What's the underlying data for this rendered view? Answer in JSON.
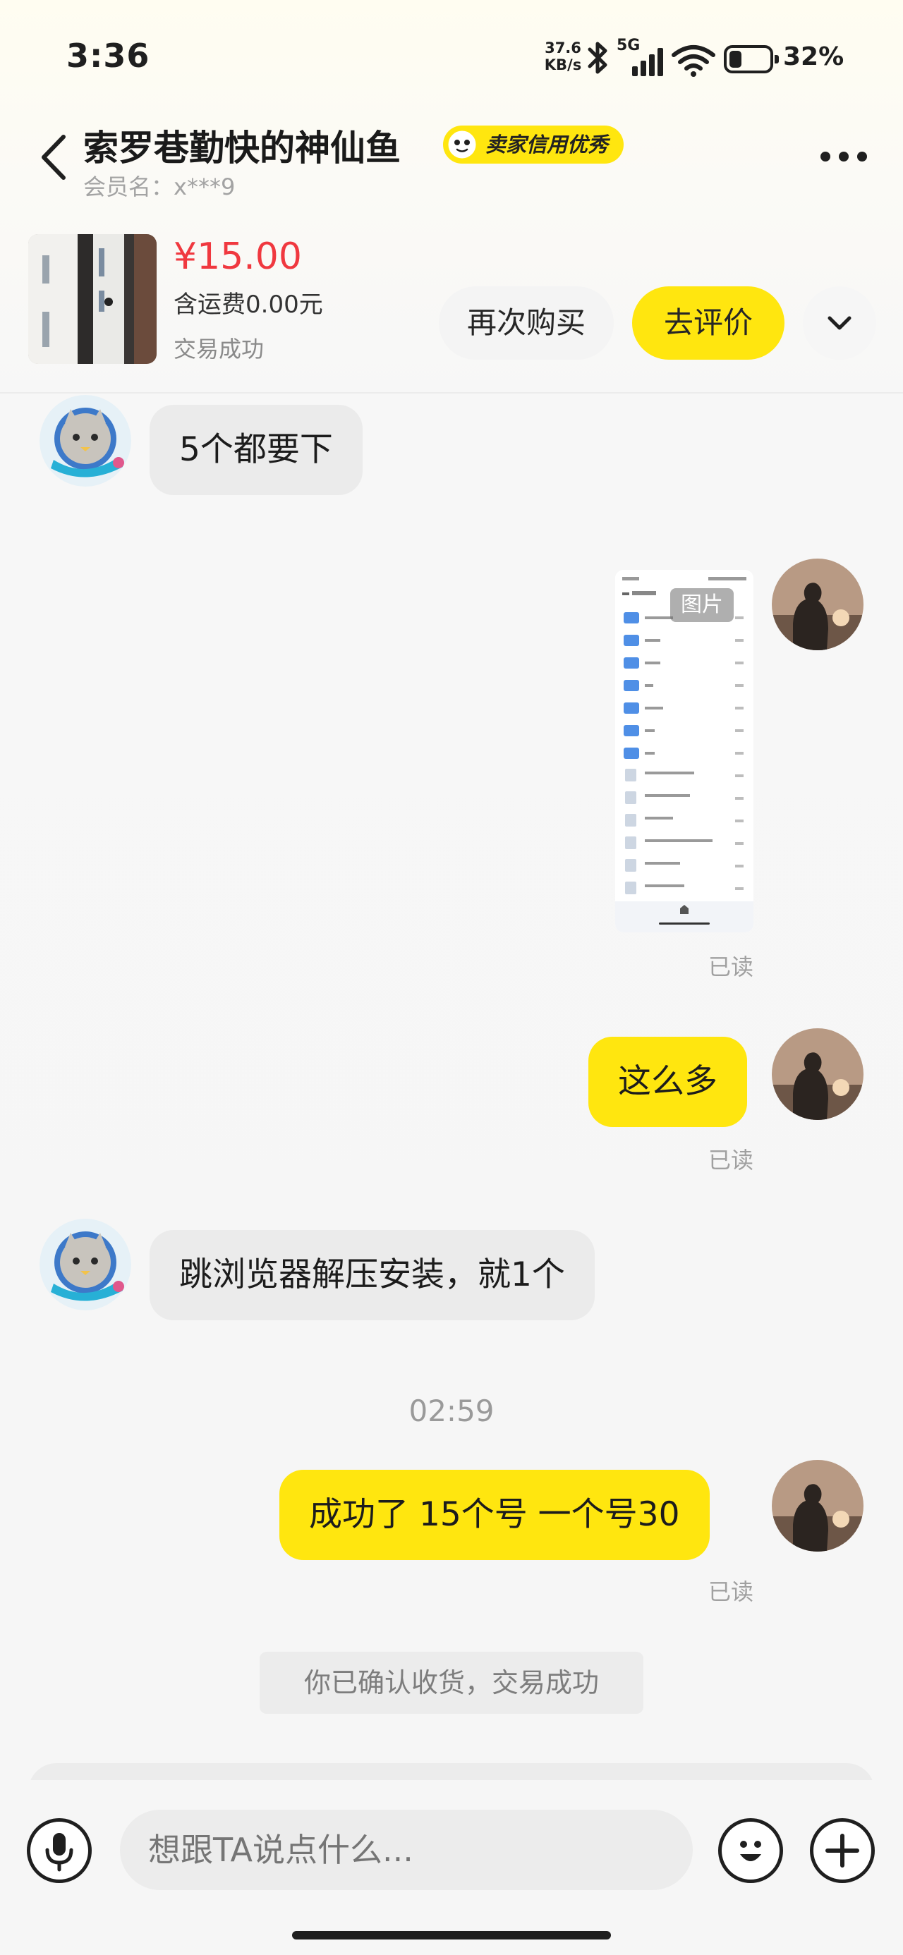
{
  "status_bar": {
    "time": "3:36",
    "speed_value": "37.6",
    "speed_unit": "KB/s",
    "network": "5G",
    "battery_percent": "32%",
    "battery_level": 0.32
  },
  "header": {
    "seller_name": "索罗巷勤快的神仙鱼",
    "seller_badge": "卖家信用优秀",
    "member_label": "会员名：x***9",
    "back_icon": "back-chevron-icon",
    "more_icon": "more-dots-icon"
  },
  "order": {
    "price": "¥15.00",
    "shipping": "含运费0.00元",
    "status": "交易成功",
    "rebuy_label": "再次购买",
    "review_label": "去评价",
    "expand_icon": "chevron-down-icon"
  },
  "messages": [
    {
      "from": "seller",
      "text": "5个都要下"
    },
    {
      "from": "me",
      "type": "image",
      "tag": "图片",
      "read": "已读"
    },
    {
      "from": "me",
      "text": "这么多",
      "read": "已读"
    },
    {
      "from": "seller",
      "text": "跳浏览器解压安装，就1个"
    },
    {
      "from": "me",
      "text": "成功了  15个号  一个号30",
      "read": "已读"
    }
  ],
  "timestamp": "02:59",
  "system_notice": "你已确认收货，交易成功",
  "composer": {
    "placeholder": "想跟TA说点什么...",
    "voice_icon": "microphone-icon",
    "emoji_icon": "emoji-icon",
    "plus_icon": "plus-icon"
  },
  "colors": {
    "accent_yellow": "#ffe60f",
    "price_red": "#f0383f",
    "incoming_bubble": "#ebebeb"
  }
}
